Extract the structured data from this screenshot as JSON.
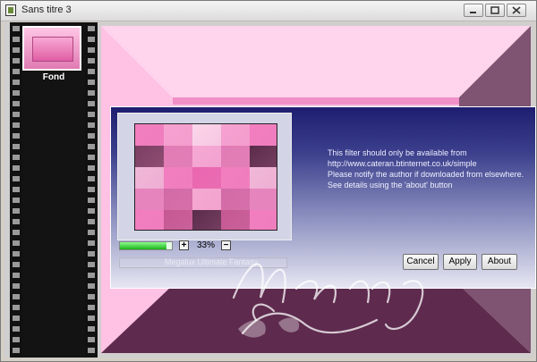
{
  "window": {
    "title": "Sans titre 3"
  },
  "filmstrip": {
    "layers": [
      {
        "label": "Fond"
      }
    ]
  },
  "dialog": {
    "zoom_percent": "33%",
    "progress_fraction": 0.9,
    "status_text": "Megalux Ultimate Fantasy",
    "info_lines": [
      "This filter should only be available from",
      "http://www.cateran.btinternet.co.uk/simple",
      "Please notify the author if downloaded from elsewhere.",
      "See details using the 'about' button"
    ],
    "buttons": {
      "cancel": "Cancel",
      "apply": "Apply",
      "about": "About"
    }
  },
  "watermark": {
    "text": "Manany"
  }
}
